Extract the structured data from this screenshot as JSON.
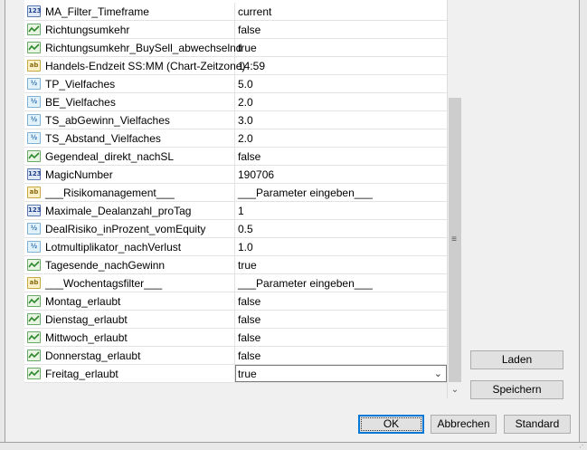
{
  "params": [
    {
      "type": "int",
      "icon": "123",
      "name": "MA_Filter_Timeframe",
      "value": "current"
    },
    {
      "type": "bool",
      "icon": "bool",
      "name": "Richtungsumkehr",
      "value": "false"
    },
    {
      "type": "bool",
      "icon": "bool",
      "name": "Richtungsumkehr_BuySell_abwechselnd",
      "value": "true"
    },
    {
      "type": "str",
      "icon": "ab",
      "name": "Handels-Endzeit SS:MM (Chart-Zeitzone)",
      "value": "14:59"
    },
    {
      "type": "dbl",
      "icon": "½",
      "name": "TP_Vielfaches",
      "value": "5.0"
    },
    {
      "type": "dbl",
      "icon": "½",
      "name": "BE_Vielfaches",
      "value": "2.0"
    },
    {
      "type": "dbl",
      "icon": "½",
      "name": "TS_abGewinn_Vielfaches",
      "value": "3.0"
    },
    {
      "type": "dbl",
      "icon": "½",
      "name": "TS_Abstand_Vielfaches",
      "value": "2.0"
    },
    {
      "type": "bool",
      "icon": "bool",
      "name": "Gegendeal_direkt_nachSL",
      "value": "false"
    },
    {
      "type": "int",
      "icon": "123",
      "name": "MagicNumber",
      "value": "190706"
    },
    {
      "type": "str",
      "icon": "ab",
      "name": "___Risikomanagement___",
      "value": "___Parameter eingeben___"
    },
    {
      "type": "int",
      "icon": "123",
      "name": "Maximale_Dealanzahl_proTag",
      "value": "1"
    },
    {
      "type": "dbl",
      "icon": "½",
      "name": "DealRisiko_inProzent_vomEquity",
      "value": "0.5"
    },
    {
      "type": "dbl",
      "icon": "½",
      "name": "Lotmultiplikator_nachVerlust",
      "value": "1.0"
    },
    {
      "type": "bool",
      "icon": "bool",
      "name": "Tagesende_nachGewinn",
      "value": "true"
    },
    {
      "type": "str",
      "icon": "ab",
      "name": "___Wochentagsfilter___",
      "value": "___Parameter eingeben___"
    },
    {
      "type": "bool",
      "icon": "bool",
      "name": "Montag_erlaubt",
      "value": "false"
    },
    {
      "type": "bool",
      "icon": "bool",
      "name": "Dienstag_erlaubt",
      "value": "false"
    },
    {
      "type": "bool",
      "icon": "bool",
      "name": "Mittwoch_erlaubt",
      "value": "false"
    },
    {
      "type": "bool",
      "icon": "bool",
      "name": "Donnerstag_erlaubt",
      "value": "false"
    },
    {
      "type": "bool",
      "icon": "bool",
      "name": "Freitag_erlaubt",
      "value": "true",
      "selected": true
    }
  ],
  "buttons": {
    "load": "Laden",
    "save": "Speichern",
    "ok": "OK",
    "cancel": "Abbrechen",
    "default": "Standard"
  },
  "icons": {
    "dropdown": "chevron-down-icon",
    "scroll_down": "arrow-down-icon",
    "scroll_grip": "grip-icon"
  }
}
